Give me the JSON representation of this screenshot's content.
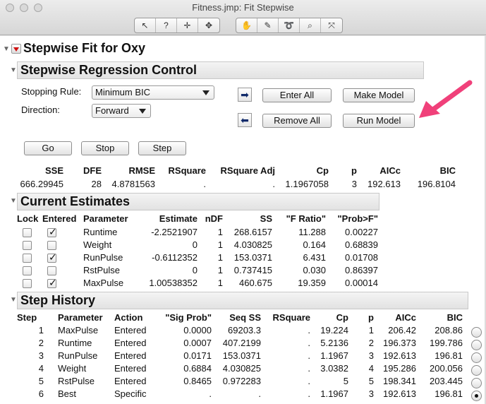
{
  "window": {
    "title": "Fitness.jmp: Fit Stepwise"
  },
  "toolbar": {
    "group1": [
      "arrow-tool-icon",
      "help-tool-icon",
      "crosshair-tool-icon",
      "move-tool-icon"
    ],
    "group2": [
      "hand-tool-icon",
      "brush-tool-icon",
      "lasso-tool-icon",
      "magnifier-tool-icon",
      "scale-tool-icon"
    ]
  },
  "report": {
    "title": "Stepwise Fit for Oxy",
    "control": {
      "title": "Stepwise Regression Control",
      "stopping_rule_label": "Stopping Rule:",
      "stopping_rule_value": "Minimum BIC",
      "direction_label": "Direction:",
      "direction_value": "Forward",
      "enter_all": "Enter All",
      "make_model": "Make Model",
      "remove_all": "Remove All",
      "run_model": "Run Model",
      "go": "Go",
      "stop": "Stop",
      "step": "Step"
    },
    "summary": {
      "headers": [
        "SSE",
        "DFE",
        "RMSE",
        "RSquare",
        "RSquare Adj",
        "Cp",
        "p",
        "AICc",
        "BIC"
      ],
      "values": [
        "666.29945",
        "28",
        "4.8781563",
        ".",
        ".",
        "1.1967058",
        "3",
        "192.613",
        "196.8104"
      ]
    },
    "estimates": {
      "title": "Current Estimates",
      "headers": [
        "Lock",
        "Entered",
        "Parameter",
        "Estimate",
        "nDF",
        "SS",
        "\"F Ratio\"",
        "\"Prob>F\""
      ],
      "rows": [
        {
          "entered": true,
          "parameter": "Runtime",
          "estimate": "-2.2521907",
          "ndf": "1",
          "ss": "268.6157",
          "f": "11.288",
          "p": "0.00227"
        },
        {
          "entered": false,
          "parameter": "Weight",
          "estimate": "0",
          "ndf": "1",
          "ss": "4.030825",
          "f": "0.164",
          "p": "0.68839"
        },
        {
          "entered": true,
          "parameter": "RunPulse",
          "estimate": "-0.6112352",
          "ndf": "1",
          "ss": "153.0371",
          "f": "6.431",
          "p": "0.01708"
        },
        {
          "entered": false,
          "parameter": "RstPulse",
          "estimate": "0",
          "ndf": "1",
          "ss": "0.737415",
          "f": "0.030",
          "p": "0.86397"
        },
        {
          "entered": true,
          "parameter": "MaxPulse",
          "estimate": "1.00538352",
          "ndf": "1",
          "ss": "460.675",
          "f": "19.359",
          "p": "0.00014"
        }
      ]
    },
    "history": {
      "title": "Step History",
      "headers": [
        "Step",
        "Parameter",
        "Action",
        "\"Sig Prob\"",
        "Seq SS",
        "RSquare",
        "Cp",
        "p",
        "AICc",
        "BIC"
      ],
      "rows": [
        {
          "step": "1",
          "parameter": "MaxPulse",
          "action": "Entered",
          "sig": "0.0000",
          "seq": "69203.3",
          "rsq": ".",
          "cp": "19.224",
          "p": "1",
          "aicc": "206.42",
          "bic": "208.86",
          "selected": false
        },
        {
          "step": "2",
          "parameter": "Runtime",
          "action": "Entered",
          "sig": "0.0007",
          "seq": "407.2199",
          "rsq": ".",
          "cp": "5.2136",
          "p": "2",
          "aicc": "196.373",
          "bic": "199.786",
          "selected": false
        },
        {
          "step": "3",
          "parameter": "RunPulse",
          "action": "Entered",
          "sig": "0.0171",
          "seq": "153.0371",
          "rsq": ".",
          "cp": "1.1967",
          "p": "3",
          "aicc": "192.613",
          "bic": "196.81",
          "selected": false
        },
        {
          "step": "4",
          "parameter": "Weight",
          "action": "Entered",
          "sig": "0.6884",
          "seq": "4.030825",
          "rsq": ".",
          "cp": "3.0382",
          "p": "4",
          "aicc": "195.286",
          "bic": "200.056",
          "selected": false
        },
        {
          "step": "5",
          "parameter": "RstPulse",
          "action": "Entered",
          "sig": "0.8465",
          "seq": "0.972283",
          "rsq": ".",
          "cp": "5",
          "p": "5",
          "aicc": "198.341",
          "bic": "203.445",
          "selected": false
        },
        {
          "step": "6",
          "parameter": "Best",
          "action": "Specific",
          "sig": ".",
          "seq": ".",
          "rsq": ".",
          "cp": "1.1967",
          "p": "3",
          "aicc": "192.613",
          "bic": "196.81",
          "selected": true
        }
      ]
    }
  },
  "annotation": {
    "arrow_color": "#f0407a"
  }
}
